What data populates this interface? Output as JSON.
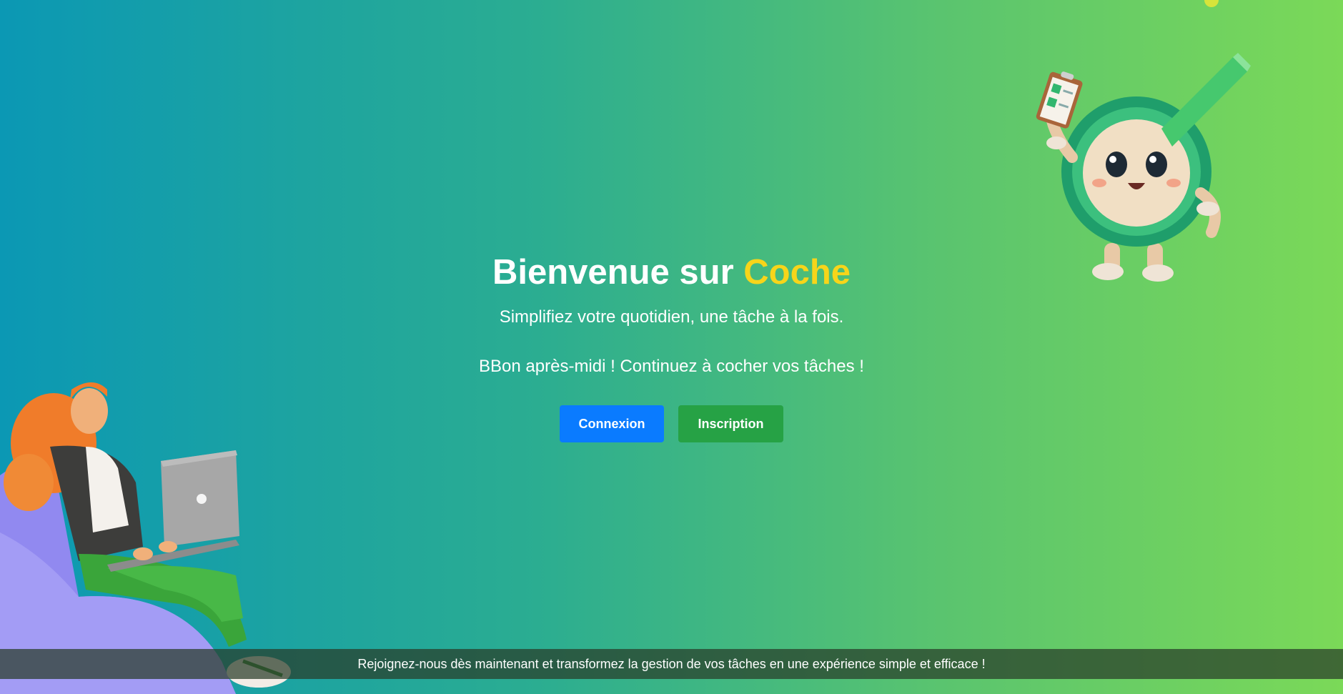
{
  "hero": {
    "title_prefix": "Bienvenue sur ",
    "title_brand": "Coche",
    "subtitle": "Simplifiez votre quotidien, une tâche à la fois.",
    "greeting": "BBon après-midi ! Continuez à cocher vos tâches !"
  },
  "buttons": {
    "login_label": "Connexion",
    "signup_label": "Inscription"
  },
  "footer": {
    "text": "Rejoignez-nous dès maintenant et transformez la gestion de vos tâches en une expérience simple et efficace !"
  },
  "colors": {
    "gradient_start": "#0b98b4",
    "gradient_end": "#7bd958",
    "brand": "#f7d51a",
    "login_button": "#0a7bff",
    "signup_button": "#26a245"
  },
  "illustrations": {
    "mascot": "checkmark-mascot-illustration",
    "woman": "woman-with-laptop-illustration"
  }
}
